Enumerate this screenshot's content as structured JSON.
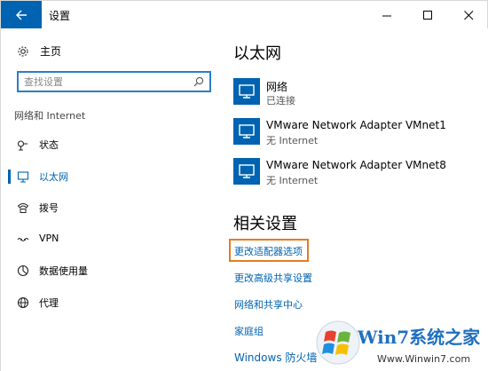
{
  "window": {
    "title": "设置"
  },
  "sidebar": {
    "home_label": "主页",
    "search_placeholder": "查找设置",
    "section_label": "网络和 Internet",
    "items": [
      {
        "label": "状态",
        "icon": "status-icon"
      },
      {
        "label": "以太网",
        "icon": "ethernet-icon",
        "active": true
      },
      {
        "label": "拨号",
        "icon": "dialup-icon"
      },
      {
        "label": "VPN",
        "icon": "vpn-icon"
      },
      {
        "label": "数据使用量",
        "icon": "data-usage-icon"
      },
      {
        "label": "代理",
        "icon": "proxy-icon"
      }
    ]
  },
  "main": {
    "title": "以太网",
    "networks": [
      {
        "name": "网络",
        "status": "已连接"
      },
      {
        "name": "VMware Network Adapter VMnet1",
        "status": "无 Internet"
      },
      {
        "name": "VMware Network Adapter VMnet8",
        "status": "无 Internet"
      }
    ],
    "related_title": "相关设置",
    "links": [
      {
        "label": "更改适配器选项"
      },
      {
        "label": "更改高级共享设置"
      },
      {
        "label": "网络和共享中心"
      },
      {
        "label": "家庭组"
      },
      {
        "label": "Windows 防火墙"
      }
    ]
  },
  "watermark": {
    "brand": "Win7系统之家",
    "url": "Www.Winwin7.com"
  },
  "colors": {
    "accent": "#0063b1",
    "highlight": "#e57b22"
  }
}
